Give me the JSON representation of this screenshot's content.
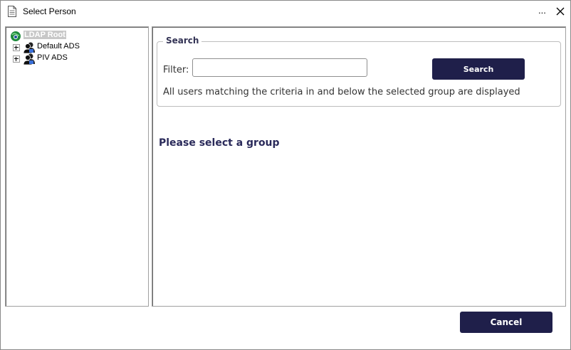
{
  "window": {
    "title": "Select Person",
    "overflow_menu": "...",
    "close_icon": "close-icon"
  },
  "tree": {
    "root": {
      "label": "LDAP Root",
      "icon": "globe-network-icon"
    },
    "children": [
      {
        "label": "Default ADS",
        "icon": "user-group-icon",
        "expandable": true
      },
      {
        "label": "PIV ADS",
        "icon": "user-group-icon",
        "expandable": true
      }
    ]
  },
  "search": {
    "legend": "Search",
    "filter_label": "Filter:",
    "filter_value": "",
    "filter_placeholder": "",
    "button_label": "Search",
    "hint": "All users matching the criteria in and below the selected group are displayed"
  },
  "main": {
    "message": "Please select a group"
  },
  "footer": {
    "cancel_label": "Cancel"
  },
  "colors": {
    "button_bg": "#1f1f4a",
    "message_text": "#2a2a5a"
  }
}
